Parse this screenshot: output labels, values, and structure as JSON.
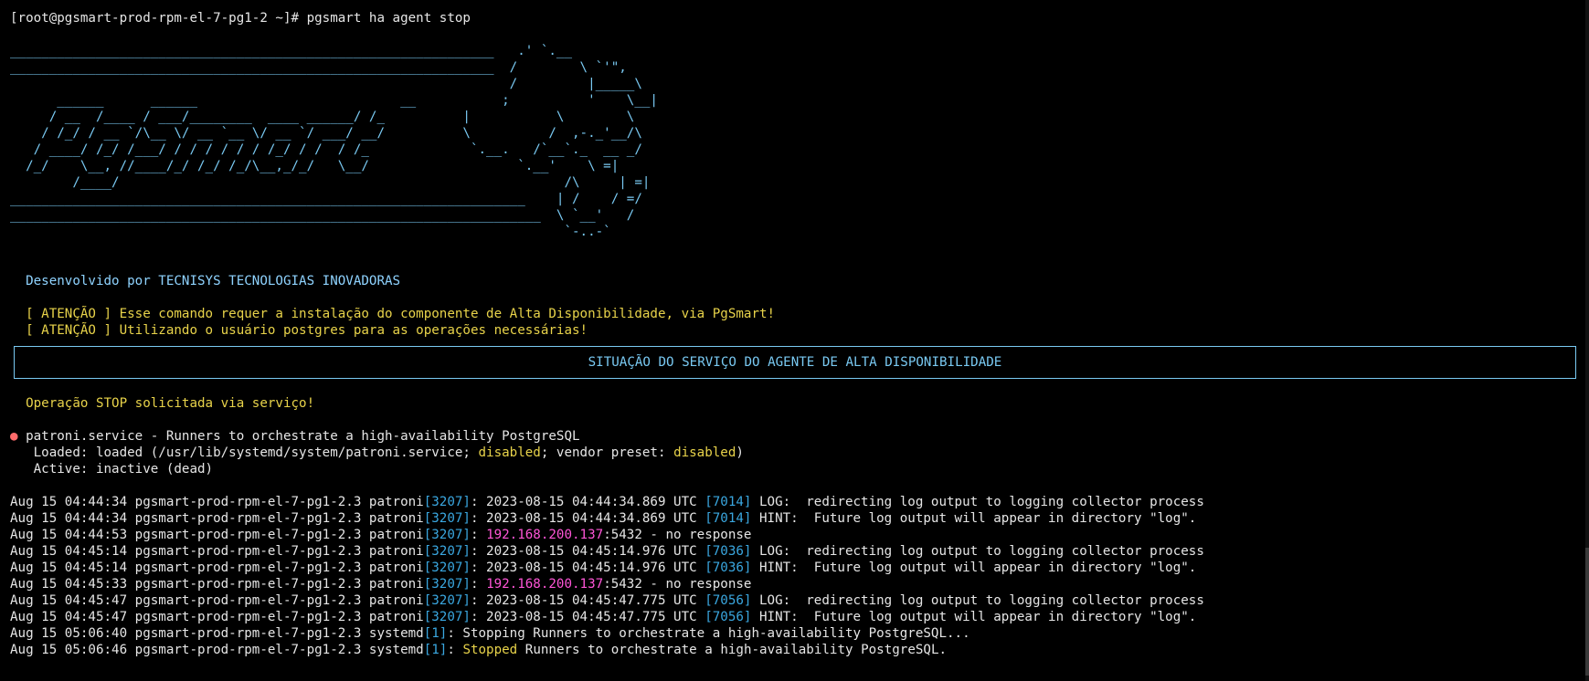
{
  "prompt": {
    "text": "[root@pgsmart-prod-rpm-el-7-pg1-2 ~]# pgsmart ha agent stop"
  },
  "logo_art": "______________________________________________________________   .' `.__\n______________________________________________________________  /        \\ `'\",\n                                                                /         |_____\\\n      ______      ______                          __           ;          '    \\__|\n     / __  /____ / ___/________  ____ ______/ /_          |           \\        \\\n    / /_/ / __ `/\\__ \\/ __ `__ \\/ __ `/ ___/ __/          \\          /  ,-._'__/\\\n   / ____/ /_/ /___/ / / / / / / /_/ / /  / /_             `.__.   /`__`._  __ _/\n  /_/    \\__, //____/_/ /_/ /_/\\__,_/_/   \\__/                   `.__'    \\ =|\n        /____/                                                         /\\     | =|\n__________________________________________________________________    | /    / =/\n____________________________________________________________________  \\ `__'   /\n                                                                       `-..-`",
  "developer": {
    "text": "  Desenvolvido por TECNISYS TECNOLOGIAS INOVADORAS"
  },
  "warnings": [
    "  [ ATENÇÃO ] Esse comando requer a instalação do componente de Alta Disponibilidade, via PgSmart!",
    "  [ ATENÇÃO ] Utilizando o usuário postgres para as operações necessárias!"
  ],
  "banner": {
    "title": "SITUAÇÃO DO SERVIÇO DO AGENTE DE ALTA DISPONIBILIDADE"
  },
  "operation": {
    "text": "  Operação STOP solicitada via serviço!"
  },
  "service": {
    "dot": "●",
    "title": " patroni.service - Runners to orchestrate a high-availability PostgreSQL",
    "loaded_prefix": "   Loaded: loaded (/usr/lib/systemd/system/patroni.service; ",
    "loaded_state": "disabled",
    "loaded_mid": "; vendor preset: ",
    "vendor_state": "disabled",
    "loaded_suffix": ")",
    "active": "   Active: inactive (dead)"
  },
  "logs": [
    {
      "prefix": "Aug 15 04:44:34 pgsmart-prod-rpm-el-7-pg1-2.3 patroni",
      "pid": "[3207]",
      "mid": ": 2023-08-15 04:44:34.869 UTC ",
      "pid2": "[7014]",
      "suffix": " LOG:  redirecting log output to logging collector process"
    },
    {
      "prefix": "Aug 15 04:44:34 pgsmart-prod-rpm-el-7-pg1-2.3 patroni",
      "pid": "[3207]",
      "mid": ": 2023-08-15 04:44:34.869 UTC ",
      "pid2": "[7014]",
      "suffix": " HINT:  Future log output will appear in directory \"log\"."
    },
    {
      "prefix": "Aug 15 04:44:53 pgsmart-prod-rpm-el-7-pg1-2.3 patroni",
      "pid": "[3207]",
      "mid": ": ",
      "ip": "192.168.200.137",
      "suffix": ":5432 - no response"
    },
    {
      "prefix": "Aug 15 04:45:14 pgsmart-prod-rpm-el-7-pg1-2.3 patroni",
      "pid": "[3207]",
      "mid": ": 2023-08-15 04:45:14.976 UTC ",
      "pid2": "[7036]",
      "suffix": " LOG:  redirecting log output to logging collector process"
    },
    {
      "prefix": "Aug 15 04:45:14 pgsmart-prod-rpm-el-7-pg1-2.3 patroni",
      "pid": "[3207]",
      "mid": ": 2023-08-15 04:45:14.976 UTC ",
      "pid2": "[7036]",
      "suffix": " HINT:  Future log output will appear in directory \"log\"."
    },
    {
      "prefix": "Aug 15 04:45:33 pgsmart-prod-rpm-el-7-pg1-2.3 patroni",
      "pid": "[3207]",
      "mid": ": ",
      "ip": "192.168.200.137",
      "suffix": ":5432 - no response"
    },
    {
      "prefix": "Aug 15 04:45:47 pgsmart-prod-rpm-el-7-pg1-2.3 patroni",
      "pid": "[3207]",
      "mid": ": 2023-08-15 04:45:47.775 UTC ",
      "pid2": "[7056]",
      "suffix": " LOG:  redirecting log output to logging collector process"
    },
    {
      "prefix": "Aug 15 04:45:47 pgsmart-prod-rpm-el-7-pg1-2.3 patroni",
      "pid": "[3207]",
      "mid": ": 2023-08-15 04:45:47.775 UTC ",
      "pid2": "[7056]",
      "suffix": " HINT:  Future log output will appear in directory \"log\"."
    },
    {
      "prefix": "Aug 15 05:06:40 pgsmart-prod-rpm-el-7-pg1-2.3 systemd",
      "pid": "[1]",
      "mid": ": Stopping Runners to orchestrate a high-availability PostgreSQL..."
    },
    {
      "prefix": "Aug 15 05:06:46 pgsmart-prod-rpm-el-7-pg1-2.3 systemd",
      "pid": "[1]",
      "mid": ": ",
      "highlight": "Stopped",
      "suffix": " Runners to orchestrate a high-availability PostgreSQL."
    }
  ]
}
